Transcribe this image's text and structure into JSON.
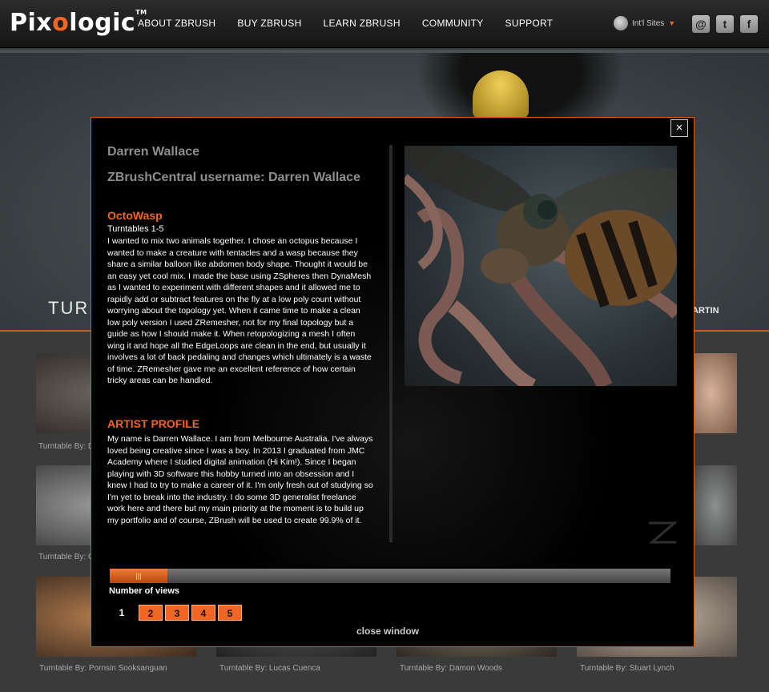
{
  "header": {
    "logo": {
      "brand_start": "Pix",
      "brand_o": "o",
      "brand_end": "logic",
      "tm": "TM"
    },
    "nav": [
      "ABOUT ZBRUSH",
      "BUY ZBRUSH",
      "LEARN ZBRUSH",
      "COMMUNITY",
      "SUPPORT"
    ],
    "intl_sites": "Int'l Sites",
    "social": {
      "email": "@",
      "twitter": "t",
      "facebook": "f"
    }
  },
  "hero": {
    "title": "TURNTABLES",
    "right_text": "ARTIN"
  },
  "gallery": {
    "captions": [
      "Turntable By: Pornsin Sooksanguan",
      "Turntable By: Lucas Cuenca",
      "Turntable By: Damon Woods",
      "Turntable By: Stuart Lynch"
    ],
    "partial_captions": [
      "Turntable By: D",
      "Turntable By: C"
    ]
  },
  "modal": {
    "close_icon": "×",
    "artist_name": "Darren Wallace",
    "username_line": "ZBrushCentral username: Darren Wallace",
    "project_title": "OctoWasp",
    "project_sub": "Turntables 1-5",
    "project_body": "I wanted to mix two animals together. I chose an octopus because I wanted to make a creature with tentacles and a wasp because they share a similar balloon like abdomen body shape. Thought it would be an easy yet cool mix. I made the base using ZSpheres then DynaMesh as I wanted to experiment with different shapes and it allowed me to rapidly add or subtract features on the fly at a low poly count without worrying about the topology yet. When it came time to make a clean low poly version I used ZRemesher, not for my final topology but a guide as how I should make it. When retopologizing a mesh I often wing it and hope all the EdgeLoops are clean in the end, but usually it involves a lot of back pedaling and changes which ultimately is a waste of time. ZRemesher gave me an excellent reference of how certain tricky areas can be handled.",
    "profile_title": "ARTIST PROFILE",
    "profile_body": "My name is Darren Wallace. I am from Melbourne Australia. I've always loved being creative since I was a boy. In 2013 I graduated from JMC Academy where I studied digital animation (Hi Kim!). Since I began playing with 3D software this hobby turned into an obsession and I knew I had to try to make a career of it. I'm only fresh out of studying so I'm yet to break into the industry. I do some 3D generalist freelance work here and there but my main priority at the moment is to build up my portfolio and of course, ZBrush will be used to create 99.9% of it.",
    "slider_grip": "|||",
    "views_label": "Number of views",
    "pages": [
      "1",
      "2",
      "3",
      "4",
      "5"
    ],
    "current_page": "1",
    "close_window": "close window"
  }
}
